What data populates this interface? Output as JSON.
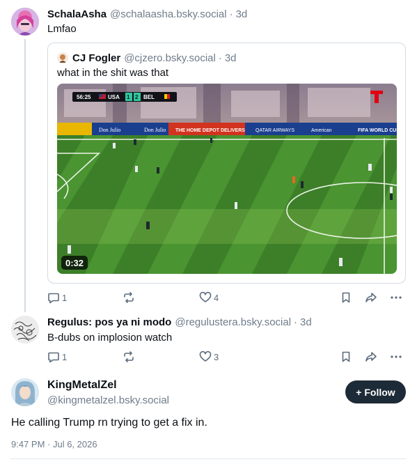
{
  "post1": {
    "display_name": "SchalaAsha",
    "handle": "@schalaasha.bsky.social",
    "sep": "·",
    "time": "3d",
    "text": "Lmfao",
    "quote": {
      "display_name": "CJ Fogler",
      "handle": "@cjzero.bsky.social",
      "sep": "·",
      "time": "3d",
      "text": "what in the shit was that",
      "video": {
        "duration": "0:32",
        "scoreboard": {
          "clock": "56:25",
          "team1": "USA",
          "score1": "1",
          "score2": "2",
          "team2": "BEL"
        },
        "ad_boards": [
          "Don Julio",
          "THE HOME DEPOT DELIVERS",
          "QATAR AIRWAYS",
          "American",
          "FIFA WORLD CUP"
        ]
      }
    },
    "reply_count": "1",
    "like_count": "4"
  },
  "post2": {
    "display_name": "Regulus: pos ya ni modo",
    "handle": "@regulustera.bsky.social",
    "sep": "·",
    "time": "3d",
    "text": "B-dubs on implosion watch",
    "reply_count": "1",
    "like_count": "3"
  },
  "main_post": {
    "display_name": "KingMetalZel",
    "handle": "@kingmetalzel.bsky.social",
    "follow_label": "+ Follow",
    "text": "He calling Trump rn trying to get a fix in.",
    "timestamp": "9:47 PM · Jul 6, 2026"
  },
  "colors": {
    "text": "#0b0f14",
    "muted": "#6f7c8b",
    "icon": "#5b6b7b",
    "border": "#d4dbe2",
    "follow_bg": "#1d2a37",
    "pitch": "#3f8a2e"
  }
}
